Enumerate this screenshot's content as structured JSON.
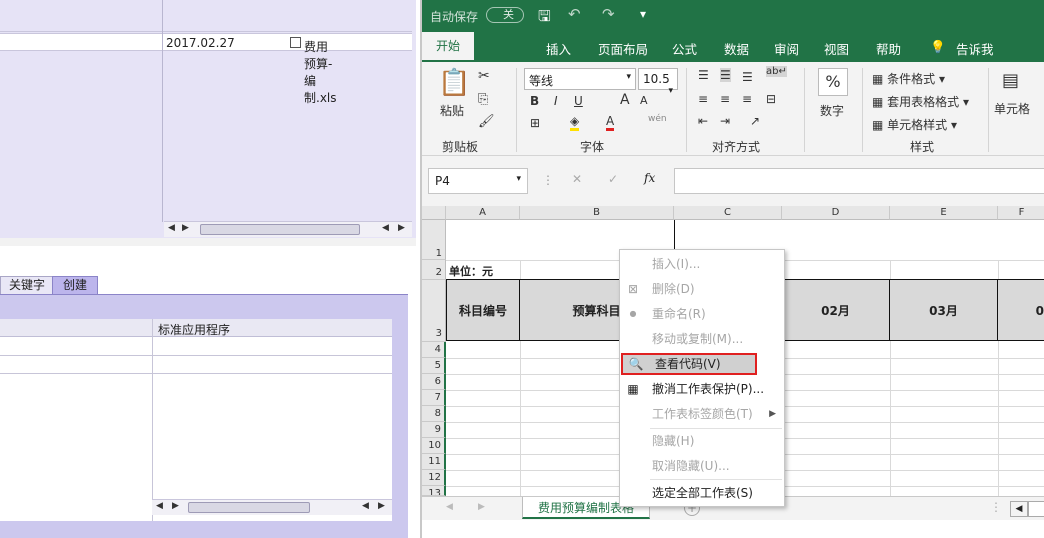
{
  "left": {
    "file_date": "2017.02.27",
    "file_name": "费用预算-编制.xls",
    "tabs": [
      "关键字",
      "创建"
    ],
    "column_header": "标准应用程序"
  },
  "excel": {
    "autosave_label": "自动保存",
    "autosave_state": "关",
    "ribbon_tabs": [
      "开始",
      "插入",
      "页面布局",
      "公式",
      "数据",
      "审阅",
      "视图",
      "帮助",
      "告诉我"
    ],
    "clipboard": {
      "paste": "粘贴",
      "group": "剪贴板"
    },
    "font": {
      "name": "等线",
      "size": "10.5",
      "group": "字体",
      "bold": "B",
      "italic": "I",
      "underline": "U",
      "wen": "wén"
    },
    "alignment": {
      "group": "对齐方式"
    },
    "number": {
      "label": "数字",
      "symbol": "%"
    },
    "styles": {
      "cond": "条件格式",
      "table": "套用表格格式",
      "cell": "单元格样式",
      "group": "样式"
    },
    "cells": {
      "label": "单元格"
    },
    "name_box": "P4",
    "columns": [
      "A",
      "B",
      "C",
      "D",
      "E",
      "F"
    ],
    "rows": [
      "1",
      "2",
      "3",
      "4",
      "5",
      "6",
      "7",
      "8",
      "9",
      "10",
      "11",
      "12",
      "13"
    ],
    "cells_text": {
      "unit": "单位：元",
      "code": "科目编号",
      "name": "预算科目",
      "m02": "02月",
      "m03": "03月",
      "m0x": "0"
    },
    "sheet_tab": "费用预算编制表格"
  },
  "context_menu": {
    "items": [
      {
        "label": "插入(I)...",
        "enabled": false
      },
      {
        "label": "删除(D)",
        "enabled": false
      },
      {
        "label": "重命名(R)",
        "enabled": false
      },
      {
        "label": "移动或复制(M)...",
        "enabled": false
      },
      {
        "label": "查看代码(V)",
        "enabled": true
      },
      {
        "label": "撤消工作表保护(P)...",
        "enabled": true
      },
      {
        "label": "工作表标签颜色(T)",
        "enabled": false
      },
      {
        "label": "隐藏(H)",
        "enabled": false
      },
      {
        "label": "取消隐藏(U)...",
        "enabled": false
      },
      {
        "label": "选定全部工作表(S)",
        "enabled": true
      }
    ]
  },
  "colors": {
    "excel_green": "#217346",
    "highlight_border": "#e02020",
    "left_panel": "#e6e3f6"
  }
}
